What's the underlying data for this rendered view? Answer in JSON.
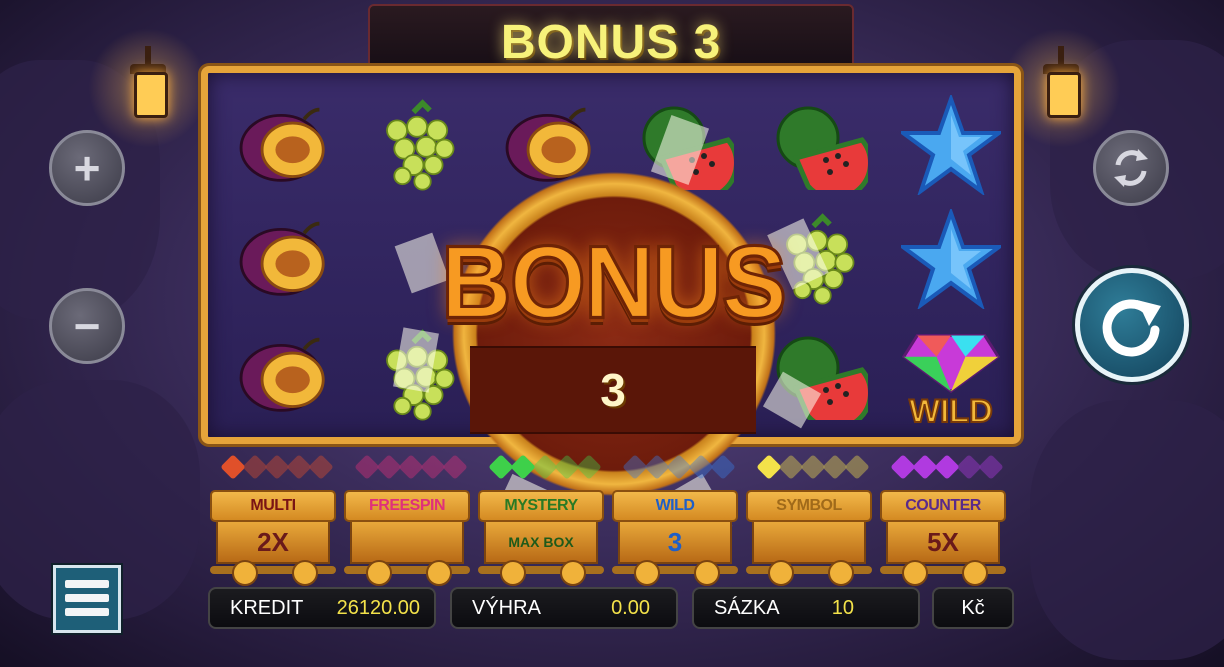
{
  "header": {
    "title": "BONUS 3"
  },
  "bonus_popup": {
    "word": "BONUS",
    "count": "3"
  },
  "reels": [
    [
      "plum",
      "plum",
      "plum"
    ],
    [
      "grapes",
      "",
      "grapes"
    ],
    [
      "plum",
      "",
      ""
    ],
    [
      "watermelon",
      "",
      ""
    ],
    [
      "watermelon",
      "grapes",
      "watermelon"
    ],
    [
      "star",
      "star",
      "wild"
    ]
  ],
  "wild_label": "WILD",
  "features": [
    {
      "label": "MULTI",
      "value": "2X",
      "label_color": "#7a1414",
      "gem_color": "#e0502a",
      "gems_lit": 1
    },
    {
      "label": "FREESPIN",
      "value": "",
      "label_color": "#e0307a",
      "gem_color": "#e0307a",
      "gems_lit": 0
    },
    {
      "label": "MYSTERY",
      "value": "MAX BOX",
      "label_color": "#2a7a24",
      "gem_color": "#3ed04a",
      "gems_lit": 2
    },
    {
      "label": "WILD",
      "value": "3",
      "label_color": "#1e5fc8",
      "gem_color": "#3a7ae0",
      "gems_lit": 0
    },
    {
      "label": "SYMBOL",
      "value": "",
      "label_color": "#a06a1a",
      "gem_color": "#f3e24a",
      "gems_lit": 1
    },
    {
      "label": "COUNTER",
      "value": "5X",
      "label_color": "#5a2a8a",
      "gem_color": "#b03ae0",
      "gems_lit": 3
    }
  ],
  "status": {
    "credit_label": "KREDIT",
    "credit_value": "26120.00",
    "win_label": "VÝHRA",
    "win_value": "0.00",
    "bet_label": "SÁZKA",
    "bet_value": "10",
    "currency": "Kč"
  },
  "icons": {
    "plus": "plus-icon",
    "minus": "minus-icon",
    "autoplay": "autoplay-icon",
    "spin": "spin-icon",
    "menu": "hamburger-menu-icon"
  },
  "colors": {
    "accent": "#f3e24a",
    "frame": "#e6a43a",
    "spin": "#1e6a88"
  }
}
